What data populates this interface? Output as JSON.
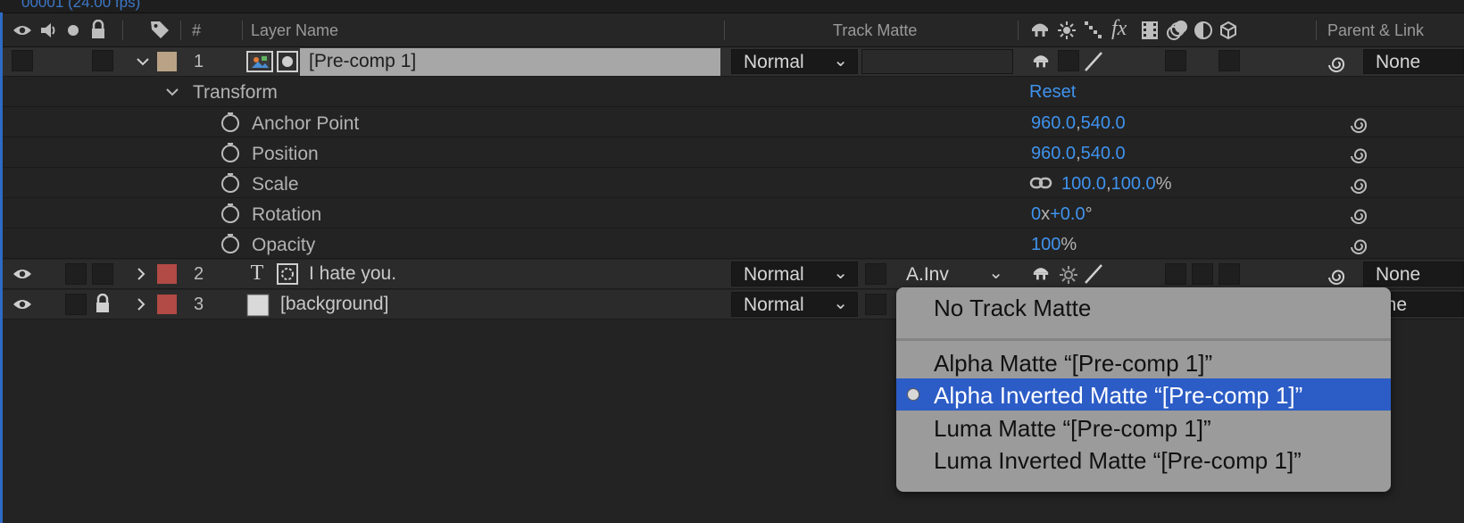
{
  "top_strip_text": "00001 (24.00 fps)",
  "columns": {
    "hash": "#",
    "layer_name": "Layer Name",
    "track_matte": "Track Matte",
    "fx": "fx",
    "parent_link": "Parent & Link"
  },
  "layers": [
    {
      "number": "1",
      "name": "[Pre-comp 1]",
      "label_color": "#b9a285",
      "mode": "Normal",
      "track_matte": "",
      "parent": "None",
      "expanded": true,
      "selected": true
    },
    {
      "number": "2",
      "name": "I hate you.",
      "label_color": "#b24a45",
      "mode": "Normal",
      "track_matte": "A.Inv",
      "parent": "None",
      "expanded": false
    },
    {
      "number": "3",
      "name": "[background]",
      "label_color": "#b24a45",
      "mode": "Normal",
      "track_matte": "",
      "parent": "one",
      "expanded": false,
      "locked": true
    }
  ],
  "transform": {
    "label": "Transform",
    "reset": "Reset",
    "props": [
      {
        "name": "Anchor Point",
        "v1": "960.0",
        "comma": ",",
        "v2": "540.0"
      },
      {
        "name": "Position",
        "v1": "960.0",
        "comma": ",",
        "v2": "540.0"
      },
      {
        "name": "Scale",
        "v1": "100.0",
        "comma": ",",
        "v2": "100.0",
        "unit": "%"
      },
      {
        "name": "Rotation",
        "v1": "0",
        "mid": "x",
        "v2": "+0.0",
        "unit": "°"
      },
      {
        "name": "Opacity",
        "v1": "100",
        "unit": "%"
      }
    ]
  },
  "track_matte_menu": {
    "items": [
      {
        "label": "No Track Matte"
      },
      {
        "label": "Alpha Matte “[Pre-comp 1]”"
      },
      {
        "label": "Alpha Inverted Matte “[Pre-comp 1]”",
        "selected": true
      },
      {
        "label": "Luma Matte “[Pre-comp 1]”"
      },
      {
        "label": "Luma Inverted Matte “[Pre-comp 1]”"
      }
    ]
  },
  "colors": {
    "accent_blue": "#3f93ee",
    "menu_highlight": "#2c5cc6",
    "panel_bg": "#232323"
  }
}
